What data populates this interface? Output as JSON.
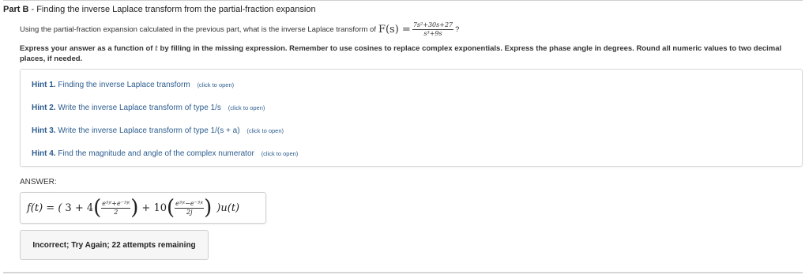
{
  "part": {
    "label": "Part B",
    "separator": " - ",
    "title": "Finding the inverse Laplace transform from the partial-fraction expansion"
  },
  "question": {
    "text": "Using the partial-fraction expansion calculated in the previous part, what is the inverse Laplace transform of",
    "function_label": "F(s) =",
    "numerator": "7s²+30s+27",
    "denominator": "s³+9s",
    "end": "?"
  },
  "instructions": {
    "prefix": "Express your answer as a function of",
    "variable": "t",
    "text": "by filling in the missing expression. Remember to use cosines to replace complex exponentials. Express the phase angle in degrees. Round all numeric values to two decimal places, if needed."
  },
  "hints": [
    {
      "number": "Hint 1.",
      "text": "Finding the inverse Laplace transform",
      "action": "(click to open)"
    },
    {
      "number": "Hint 2.",
      "text": "Write the inverse Laplace transform of type 1/s",
      "action": "(click to open)"
    },
    {
      "number": "Hint 3.",
      "text": "Write the inverse Laplace transform of type 1/(s + a)",
      "action": "(click to open)"
    },
    {
      "number": "Hint 4.",
      "text": "Find the magnitude and angle of the complex numerator",
      "action": "(click to open)"
    }
  ],
  "answer": {
    "label": "ANSWER:",
    "lhs": "f(t) = (",
    "term1": "3 + 4",
    "frac1_num": "e³ʲᵗ+e⁻³ʲᵗ",
    "frac1_den": "2",
    "plus": "+ 10",
    "frac2_num": "e³ʲᵗ−e⁻³ʲᵗ",
    "frac2_den": "2j",
    "rhs": ")u(t)"
  },
  "feedback": {
    "text": "Incorrect; Try Again; 22 attempts remaining"
  }
}
